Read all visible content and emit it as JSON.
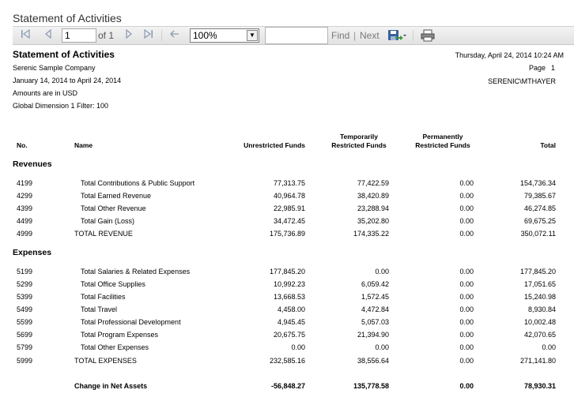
{
  "window": {
    "title": "Statement of Activities"
  },
  "toolbar": {
    "page_value": "1",
    "page_of": "of 1",
    "zoom": "100%",
    "find_label": "Find",
    "separator": "|",
    "next_label": "Next"
  },
  "report": {
    "title": "Statement of Activities",
    "company": "Serenic Sample Company",
    "date_range": "January 14, 2014 to April 24, 2014",
    "currency": "Amounts are in USD",
    "filter": "Global Dimension 1 Filter: 100",
    "run_datetime": "Thursday, April 24, 2014 10:24 AM",
    "page_label": "Page",
    "page_number": "1",
    "user": "SERENIC\\MTHAYER"
  },
  "columns": {
    "no": "No.",
    "name": "Name",
    "unrestricted": "Unrestricted Funds",
    "temp_1": "Temporarily",
    "temp_2": "Restricted Funds",
    "perm_1": "Permanently",
    "perm_2": "Restricted Funds",
    "total": "Total"
  },
  "revenues": {
    "heading": "Revenues",
    "rows": [
      {
        "no": "4199",
        "name": "Total Contributions & Public Support",
        "unrestricted": "77,313.75",
        "temporary": "77,422.59",
        "permanent": "0.00",
        "total": "154,736.34"
      },
      {
        "no": "4299",
        "name": "Total Earned Revenue",
        "unrestricted": "40,964.78",
        "temporary": "38,420.89",
        "permanent": "0.00",
        "total": "79,385.67"
      },
      {
        "no": "4399",
        "name": "Total Other Revenue",
        "unrestricted": "22,985.91",
        "temporary": "23,288.94",
        "permanent": "0.00",
        "total": "46,274.85"
      },
      {
        "no": "4499",
        "name": "Total Gain (Loss)",
        "unrestricted": "34,472.45",
        "temporary": "35,202.80",
        "permanent": "0.00",
        "total": "69,675.25"
      }
    ],
    "total": {
      "no": "4999",
      "name": "TOTAL REVENUE",
      "unrestricted": "175,736.89",
      "temporary": "174,335.22",
      "permanent": "0.00",
      "total": "350,072.11"
    }
  },
  "expenses": {
    "heading": "Expenses",
    "rows": [
      {
        "no": "5199",
        "name": "Total Salaries & Related Expenses",
        "unrestricted": "177,845.20",
        "temporary": "0.00",
        "permanent": "0.00",
        "total": "177,845.20"
      },
      {
        "no": "5299",
        "name": "Total Office Supplies",
        "unrestricted": "10,992.23",
        "temporary": "6,059.42",
        "permanent": "0.00",
        "total": "17,051.65"
      },
      {
        "no": "5399",
        "name": "Total Facilities",
        "unrestricted": "13,668.53",
        "temporary": "1,572.45",
        "permanent": "0.00",
        "total": "15,240.98"
      },
      {
        "no": "5499",
        "name": "Total Travel",
        "unrestricted": "4,458.00",
        "temporary": "4,472.84",
        "permanent": "0.00",
        "total": "8,930.84"
      },
      {
        "no": "5599",
        "name": "Total Professional Development",
        "unrestricted": "4,945.45",
        "temporary": "5,057.03",
        "permanent": "0.00",
        "total": "10,002.48"
      },
      {
        "no": "5699",
        "name": "Total Program Expenses",
        "unrestricted": "20,675.75",
        "temporary": "21,394.90",
        "permanent": "0.00",
        "total": "42,070.65"
      },
      {
        "no": "5799",
        "name": "Total Other Expenses",
        "unrestricted": "0.00",
        "temporary": "0.00",
        "permanent": "0.00",
        "total": "0.00"
      }
    ],
    "total": {
      "no": "5999",
      "name": "TOTAL EXPENSES",
      "unrestricted": "232,585.16",
      "temporary": "38,556.64",
      "permanent": "0.00",
      "total": "271,141.80"
    }
  },
  "net": {
    "name": "Change in Net Assets",
    "unrestricted": "-56,848.27",
    "temporary": "135,778.58",
    "permanent": "0.00",
    "total": "78,930.31"
  },
  "icons": {
    "first": "first-page-icon",
    "prev": "previous-page-icon",
    "next": "next-page-icon",
    "last": "last-page-icon",
    "back": "back-to-parent-icon",
    "export": "export-save-icon",
    "print": "printer-icon"
  }
}
